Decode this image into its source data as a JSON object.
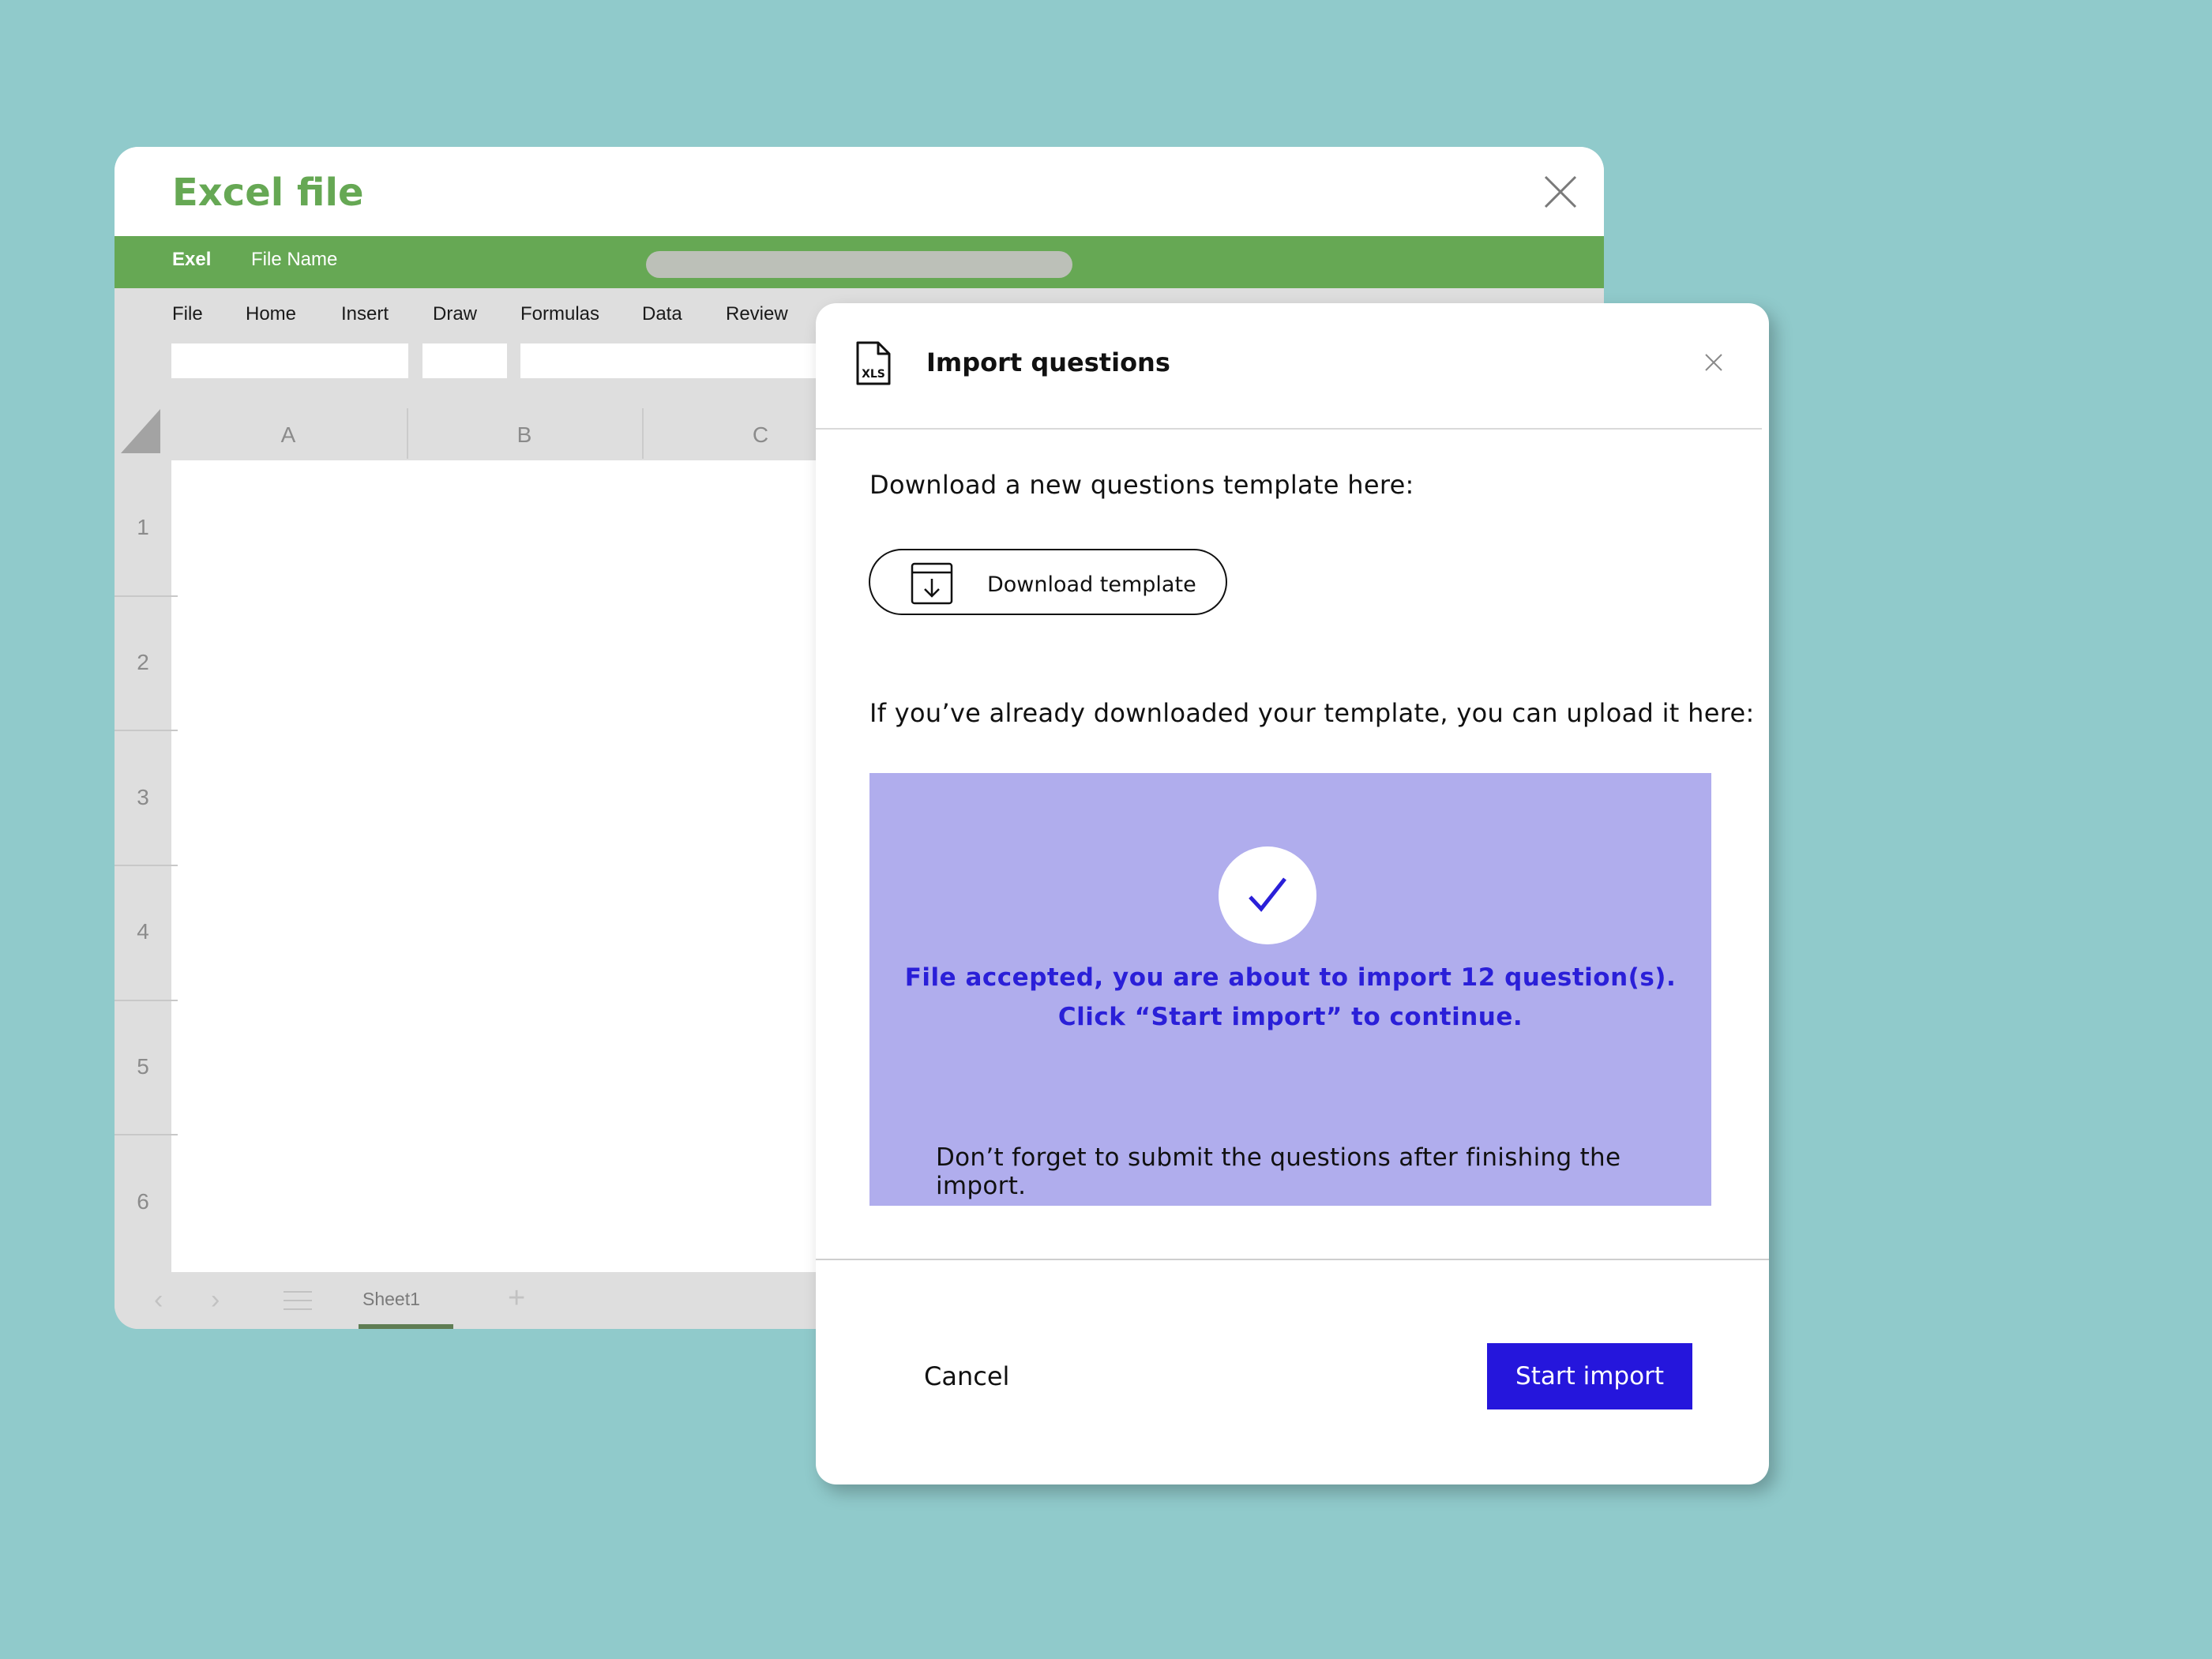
{
  "excel": {
    "title": "Excel file",
    "app_name": "Exel",
    "file_name": "File Name",
    "menu": [
      "File",
      "Home",
      "Insert",
      "Draw",
      "Formulas",
      "Data",
      "Review"
    ],
    "columns": [
      "A",
      "B",
      "C"
    ],
    "rows": [
      "1",
      "2",
      "3",
      "4",
      "5",
      "6"
    ],
    "sheet_tab": "Sheet1",
    "add_sheet": "+",
    "colors": {
      "brand": "#66a854",
      "tab_underline": "#5f7d54"
    },
    "icons": [
      "close-icon",
      "select-all-corner-icon",
      "prev-sheet-icon",
      "next-sheet-icon",
      "sheet-list-icon",
      "add-sheet-icon"
    ]
  },
  "dialog": {
    "title": "Import questions",
    "file_icon_label": "XLS",
    "download_prompt": "Download a new questions template here:",
    "download_button": "Download template",
    "upload_prompt": "If you’ve already downloaded your template, you can upload it here:",
    "accepted_line1": "File accepted, you are about to import 12 question(s).",
    "accepted_line2": "Click “Start import” to continue.",
    "reminder": "Don’t forget to submit the questions after finishing the import.",
    "cancel": "Cancel",
    "start": "Start import",
    "colors": {
      "dropzone": "#b0aded",
      "accent": "#2516dc",
      "message": "#2a1fd8"
    },
    "icons": [
      "xls-file-icon",
      "close-icon",
      "download-icon",
      "checkmark-icon"
    ]
  }
}
